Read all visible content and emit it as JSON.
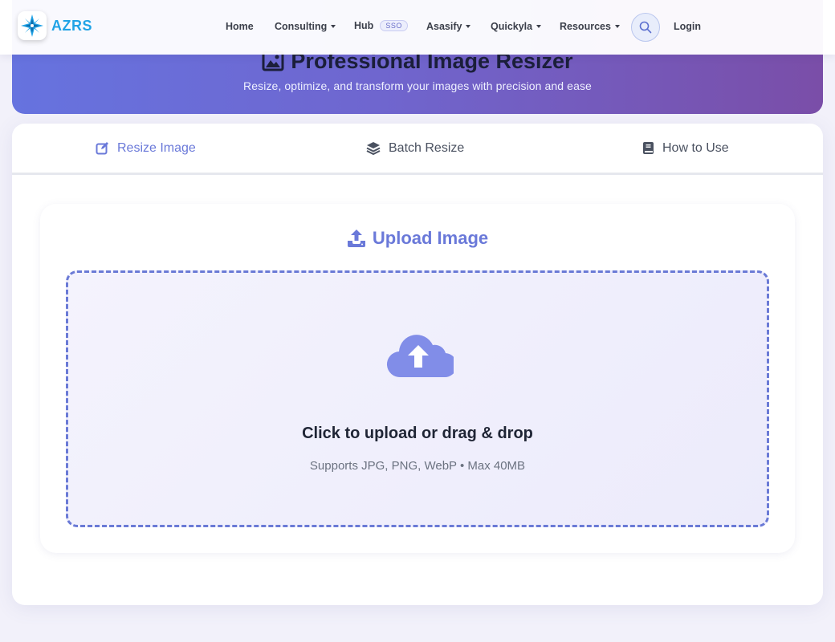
{
  "hero": {
    "title": "Professional Image Resizer",
    "subtitle": "Resize, optimize, and transform your images with precision and ease"
  },
  "navbar": {
    "brand": "AZRS",
    "links": {
      "home": "Home",
      "consulting": "Consulting",
      "hub": "Hub",
      "hub_badge": "SSO",
      "asasify": "Asasify",
      "quickyla": "Quickyla",
      "resources": "Resources",
      "login": "Login"
    },
    "icons": {
      "search": "search-icon"
    }
  },
  "tabs": {
    "resize": "Resize Image",
    "batch": "Batch Resize",
    "howto": "How to Use",
    "active": "resize"
  },
  "upload": {
    "heading": "Upload Image",
    "drop_title": "Click to upload or drag & drop",
    "drop_subtitle": "Supports JPG, PNG, WebP • Max 40MB"
  },
  "colors": {
    "accent": "#6a79d9",
    "brand": "#21a3e6",
    "hero_start": "#6673df",
    "hero_end": "#7a4ea8"
  }
}
